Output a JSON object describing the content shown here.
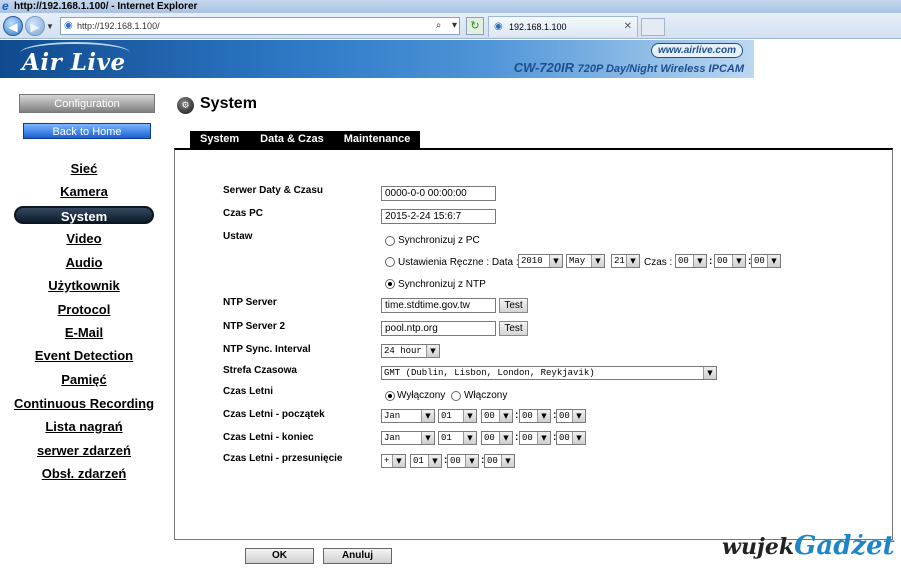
{
  "browser": {
    "title": "http://192.168.1.100/ - Internet Explorer",
    "url": "http://192.168.1.100/",
    "tab_title": "192.168.1.100"
  },
  "brand": {
    "logo": "Air Live",
    "site": "www.airlive.com",
    "model": "CW-720IR",
    "model_desc": "720P Day/Night Wireless IPCAM"
  },
  "sidebar": {
    "config_label": "Configuration",
    "home_label": "Back to Home",
    "items": [
      "Sieć",
      "Kamera",
      "System",
      "Video",
      "Audio",
      "Użytkownik",
      "Protocol",
      "E-Mail",
      "Event Detection",
      "Pamięć",
      "Continuous Recording",
      "Lista nagrań",
      "serwer zdarzeń",
      "Obsł. zdarzeń"
    ],
    "active_index": 2
  },
  "page": {
    "title": "System",
    "tabs": [
      "System",
      "Data & Czas",
      "Maintenance"
    ],
    "active_tab": 1
  },
  "form": {
    "server_time_label": "Serwer Daty & Czasu",
    "server_time_value": "0000-0-0 00:00:00",
    "pc_time_label": "Czas PC",
    "pc_time_value": "2015-2-24 15:6:7",
    "set_label": "Ustaw",
    "opt_sync_pc": "Synchronizuj z PC",
    "opt_manual": "Ustawienia Ręczne : Data :",
    "manual_year": "2010",
    "manual_month": "May",
    "manual_day": "21",
    "manual_time_label": "Czas :",
    "manual_hh": "00",
    "manual_mm": "00",
    "manual_ss": "00",
    "opt_sync_ntp": "Synchronizuj z NTP",
    "ntp_server_label": "NTP Server",
    "ntp_server_value": "time.stdtime.gov.tw",
    "ntp_server2_label": "NTP Server 2",
    "ntp_server2_value": "pool.ntp.org",
    "test_label": "Test",
    "ntp_interval_label": "NTP Sync. Interval",
    "ntp_interval_value": "24 hour",
    "timezone_label": "Strefa Czasowa",
    "timezone_value": "GMT (Dublin, Lisbon, London, Reykjavik)",
    "dst_label": "Czas Letni",
    "dst_off": "Wyłączony",
    "dst_on": "Włączony",
    "dst_start_label": "Czas Letni - początek",
    "dst_start": {
      "month": "Jan",
      "day": "01",
      "hh": "00",
      "mm": "00",
      "ss": "00"
    },
    "dst_end_label": "Czas Letni - koniec",
    "dst_end": {
      "month": "Jan",
      "day": "01",
      "hh": "00",
      "mm": "00",
      "ss": "00"
    },
    "dst_offset_label": "Czas Letni - przesunięcie",
    "dst_offset": {
      "sign": "+",
      "hh": "01",
      "mm": "00",
      "ss": "00"
    },
    "colon": ":"
  },
  "actions": {
    "ok": "OK",
    "cancel": "Anuluj"
  },
  "watermark": {
    "part1": "wujek",
    "part2": "Gadżet"
  },
  "icons": {
    "system_title": "system-icon",
    "dropdown": "chevron-down-icon",
    "back": "back-arrow-icon",
    "forward": "forward-arrow-icon"
  }
}
